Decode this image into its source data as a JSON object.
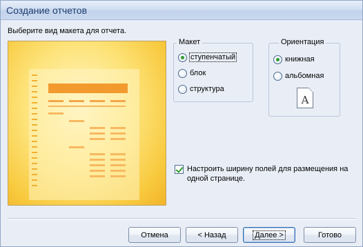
{
  "window": {
    "title": "Создание отчетов"
  },
  "instruction": "Выберите вид макета для отчета.",
  "layout_group": {
    "legend": "Макет",
    "options": [
      {
        "label": "ступенчатый",
        "checked": true
      },
      {
        "label": "блок",
        "checked": false
      },
      {
        "label": "структура",
        "checked": false
      }
    ]
  },
  "orientation_group": {
    "legend": "Ориентация",
    "options": [
      {
        "label": "книжная",
        "checked": true
      },
      {
        "label": "альбомная",
        "checked": false
      }
    ],
    "preview_letter": "A"
  },
  "fit_checkbox": {
    "label": "Настроить ширину полей для размещения на одной странице.",
    "checked": true
  },
  "buttons": {
    "cancel": "Отмена",
    "back": "< Назад",
    "next": "Далее >",
    "finish": "Готово"
  },
  "colors": {
    "accent_orange": "#f29a2e",
    "preview_yellow": "#fde37a",
    "radio_green": "#2f9a2f"
  }
}
